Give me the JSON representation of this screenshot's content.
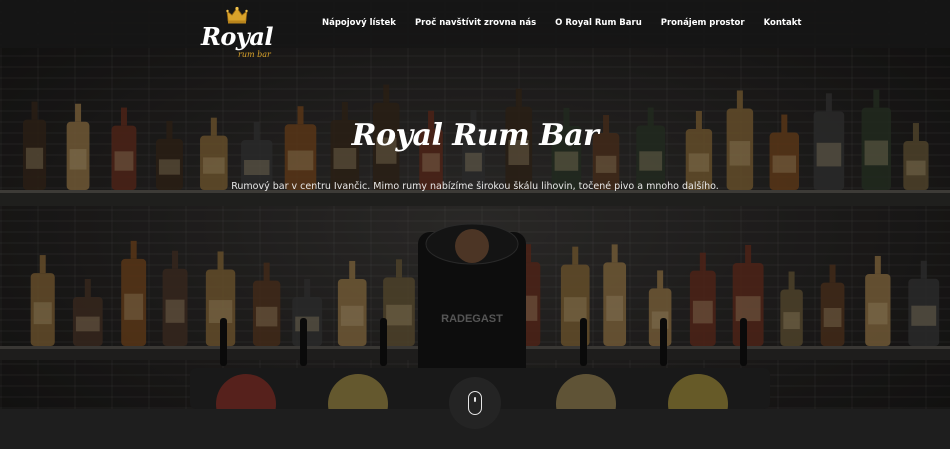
{
  "brand": {
    "logo_main": "Royal",
    "logo_sub": "rum bar"
  },
  "nav": {
    "items": [
      {
        "label": "Nápojový lístek"
      },
      {
        "label": "Proč navštívit zrovna nás"
      },
      {
        "label": "O Royal Rum Baru"
      },
      {
        "label": "Pronájem prostor"
      },
      {
        "label": "Kontakt"
      }
    ]
  },
  "hero": {
    "title": "Royal Rum Bar",
    "subtitle": "Rumový bar v centru Ivančic. Mimo rumy nabízíme širokou škálu lihovin, točené pivo a mnoho dalšího."
  },
  "scroll_indicator": {
    "icon": "mouse-icon"
  },
  "colors": {
    "accent_gold": "#d9a22a",
    "header_bg": "#161616",
    "page_bg": "#1e1e1e",
    "text": "#ffffff"
  }
}
